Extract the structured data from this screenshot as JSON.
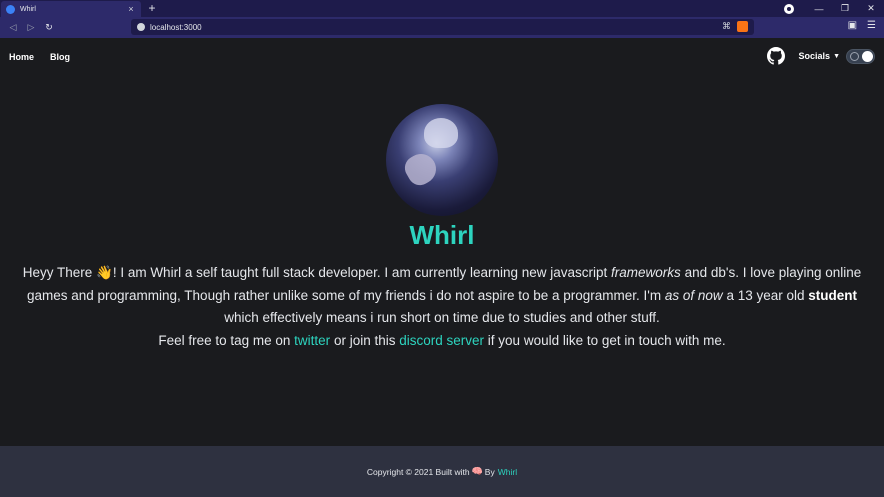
{
  "browser": {
    "tab_title": "Whirl",
    "tab_close": "×",
    "new_tab": "+",
    "url": "localhost:3000",
    "win_minimize": "—",
    "win_restore": "❐",
    "win_close": "✕"
  },
  "nav": {
    "home": "Home",
    "blog": "Blog",
    "socials": "Socials"
  },
  "profile": {
    "name": "Whirl"
  },
  "bio": {
    "p1": "Heyy There",
    "wave": "👋",
    "p2": "! I am Whirl a self taught full stack developer. I am currently learning new javascript",
    "frameworks": "frameworks",
    "p3": "and db's. I love playing online games and programming, Though rather unlike some of my friends i do not aspire to be a programmer. I'm",
    "as_of_now": "as of now",
    "p4": "a 13 year old",
    "student": "student",
    "p5": "which effectively means i run short on time due to studies and other stuff.",
    "p6": "Feel free to tag me on",
    "twitter": "twitter",
    "p7": "or join this",
    "discord": "discord server",
    "p8": "if you would like to get in touch with me."
  },
  "footer": {
    "text": "Copyright © 2021 Built with",
    "emoji": "🧠",
    "by": "By",
    "author": "Whirl"
  },
  "colors": {
    "accent": "#2dd4bf",
    "background": "#1a1b1e",
    "footer": "#2e3140"
  }
}
